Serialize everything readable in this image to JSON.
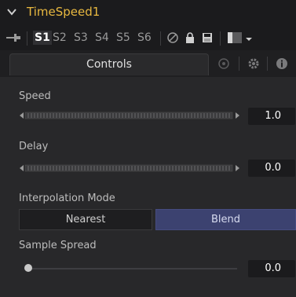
{
  "header": {
    "title": "TimeSpeed1"
  },
  "slots": [
    "S1",
    "S2",
    "S3",
    "S4",
    "S5",
    "S6"
  ],
  "active_slot": "S1",
  "tabs": {
    "controls": "Controls"
  },
  "params": {
    "speed": {
      "label": "Speed",
      "value": "1.0"
    },
    "delay": {
      "label": "Delay",
      "value": "0.0"
    },
    "interpolation": {
      "label": "Interpolation Mode",
      "options": [
        "Nearest",
        "Blend"
      ],
      "selected": "Blend"
    },
    "sample_spread": {
      "label": "Sample Spread",
      "value": "0.0",
      "level": 0.0
    }
  },
  "colors": {
    "title": "#e8b840",
    "accent_selected": "#3c4270",
    "background": "#28282a",
    "header": "#1b1b1d"
  },
  "icons": [
    "chevron-down-icon",
    "pin-icon",
    "no-entry-icon",
    "lock-icon",
    "save-icon",
    "color-swatch-icon",
    "dropdown-arrow-icon",
    "node-icon",
    "gear-icon",
    "info-icon"
  ]
}
